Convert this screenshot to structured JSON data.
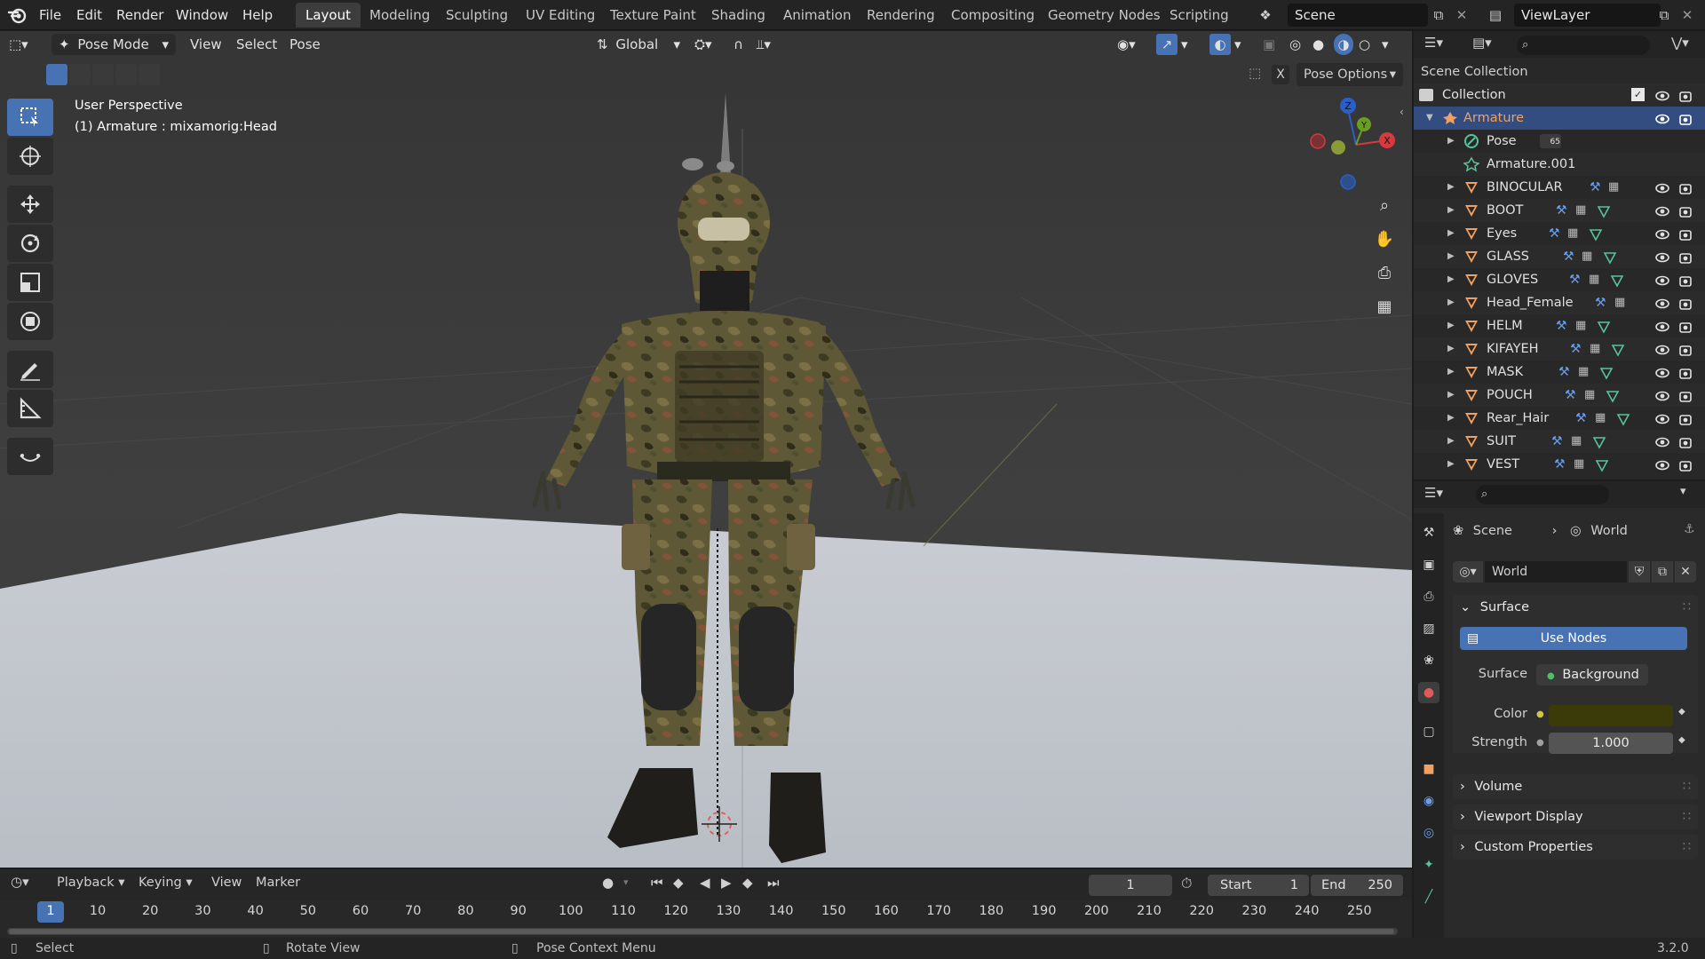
{
  "menubar": {
    "items": [
      "File",
      "Edit",
      "Render",
      "Window",
      "Help"
    ],
    "workspaces": [
      "Layout",
      "Modeling",
      "Sculpting",
      "UV Editing",
      "Texture Paint",
      "Shading",
      "Animation",
      "Rendering",
      "Compositing",
      "Geometry Nodes",
      "Scripting"
    ],
    "active_workspace": "Layout",
    "scene": "Scene",
    "view_layer": "ViewLayer"
  },
  "viewport": {
    "mode": "Pose Mode",
    "menus": [
      "View",
      "Select",
      "Pose"
    ],
    "transform_orientation": "Global",
    "pose_options": "Pose Options",
    "overlay_line1": "User Perspective",
    "overlay_line2": "(1) Armature : mixamorig:Head",
    "gizmo_axes": {
      "z": "Z",
      "y": "Y",
      "x": "X"
    },
    "x_button": "X"
  },
  "outliner": {
    "scene_collection": "Scene Collection",
    "collection": "Collection",
    "armature": "Armature",
    "pose": "Pose",
    "pose_count": "65",
    "armature_data": "Armature.001",
    "objects": [
      "BINOCULAR",
      "BOOT",
      "Eyes",
      "GLASS",
      "GLOVES",
      "Head_Female",
      "HELM",
      "KIFAYEH",
      "MASK",
      "POUCH",
      "Rear_Hair",
      "SUIT",
      "VEST"
    ]
  },
  "properties": {
    "breadcrumb_scene": "Scene",
    "breadcrumb_world": "World",
    "world_name": "World",
    "panels": {
      "surface": "Surface",
      "use_nodes": "Use Nodes",
      "surface_label": "Surface",
      "surface_value": "Background",
      "color_label": "Color",
      "strength_label": "Strength",
      "strength_value": "1.000",
      "volume": "Volume",
      "viewport_display": "Viewport Display",
      "custom_properties": "Custom Properties"
    },
    "colors": {
      "world_color": "#3b3b0a",
      "accent": "#4772b3"
    }
  },
  "timeline": {
    "menus": [
      "Playback",
      "Keying",
      "View",
      "Marker"
    ],
    "current_frame": "1",
    "start_label": "Start",
    "start_value": "1",
    "end_label": "End",
    "end_value": "250",
    "ticks": [
      "1",
      "10",
      "20",
      "30",
      "40",
      "50",
      "60",
      "70",
      "80",
      "90",
      "100",
      "110",
      "120",
      "130",
      "140",
      "150",
      "160",
      "170",
      "180",
      "190",
      "200",
      "210",
      "220",
      "230",
      "240",
      "250"
    ]
  },
  "statusbar": {
    "select": "Select",
    "rotate_view": "Rotate View",
    "context_menu": "Pose Context Menu",
    "version": "3.2.0"
  }
}
